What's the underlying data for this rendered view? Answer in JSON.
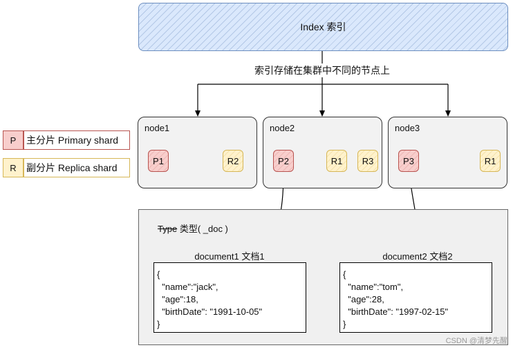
{
  "index": {
    "label": "Index 索引"
  },
  "edge_label": "索引存储在集群中不同的节点上",
  "legend": [
    {
      "code": "P",
      "text": "主分片 Primary shard",
      "color": "#b85450"
    },
    {
      "code": "R",
      "text": "副分片 Replica shard",
      "color": "#d6b656"
    }
  ],
  "nodes": [
    {
      "label": "node1",
      "shards": [
        {
          "name": "P1",
          "kind": "primary"
        },
        {
          "name": "R2",
          "kind": "replica"
        }
      ]
    },
    {
      "label": "node2",
      "shards": [
        {
          "name": "P2",
          "kind": "primary"
        },
        {
          "name": "R1",
          "kind": "replica"
        },
        {
          "name": "R3",
          "kind": "replica"
        }
      ]
    },
    {
      "label": "node3",
      "shards": [
        {
          "name": "P3",
          "kind": "primary"
        },
        {
          "name": "R1",
          "kind": "replica"
        }
      ]
    }
  ],
  "type_box": {
    "struck": "Type",
    "label": "类型( _doc )"
  },
  "documents": [
    {
      "title": "document1 文档1",
      "lines": [
        "{",
        "  \"name\":\"jack\",",
        "  \"age\":18,",
        "  \"birthDate\": \"1991-10-05\"",
        "}"
      ]
    },
    {
      "title": "document2 文档2",
      "lines": [
        "{",
        "  \"name\":\"tom\",",
        "  \"age\":28,",
        "  \"birthDate\": \"1997-02-15\"",
        "}"
      ]
    }
  ],
  "watermark": "CSDN @清梦先醒"
}
